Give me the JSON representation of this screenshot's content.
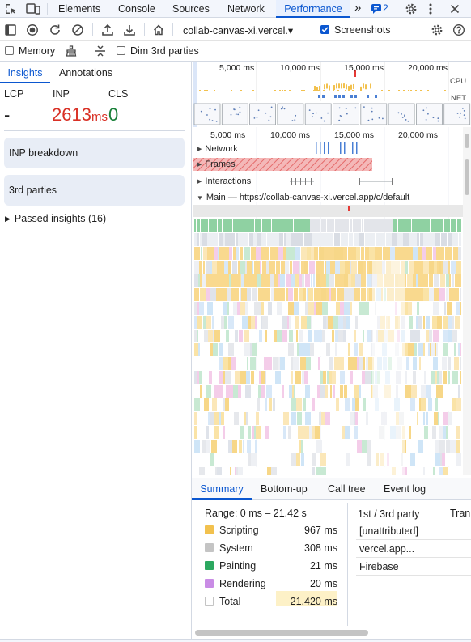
{
  "tabs": {
    "elements": "Elements",
    "console": "Console",
    "sources": "Sources",
    "network": "Network",
    "performance": "Performance",
    "more": "»",
    "issues_count": "2"
  },
  "toolbar": {
    "recording_select": "collab-canvas-xi.vercel.▾",
    "screenshots_label": "Screenshots",
    "screenshots_checked": true,
    "memory_label": "Memory",
    "memory_checked": false,
    "dim3p_label": "Dim 3rd parties",
    "dim3p_checked": false
  },
  "sidebar": {
    "tab_insights": "Insights",
    "tab_annotations": "Annotations",
    "lcp_label": "LCP",
    "inp_label": "INP",
    "cls_label": "CLS",
    "lcp_value": "-",
    "inp_value": "2613",
    "inp_unit": "ms",
    "cls_value": "0",
    "inp_breakdown": "INP breakdown",
    "third_parties": "3rd parties",
    "passed_insights": "Passed insights (16)"
  },
  "overview": {
    "ticks": [
      "5,000 ms",
      "10,000 ms",
      "15,000 ms",
      "20,000 ms"
    ],
    "cpu_label": "CPU",
    "net_label": "NET"
  },
  "timeline": {
    "ticks": [
      "5,000 ms",
      "10,000 ms",
      "15,000 ms",
      "20,000 ms"
    ],
    "network_label": "Network",
    "frames_label": "Frames",
    "interactions_label": "Interactions",
    "main_label": "Main — https://collab-canvas-xi.vercel.app/c/default"
  },
  "bottom": {
    "tabs": [
      "Summary",
      "Bottom-up",
      "Call tree",
      "Event log"
    ],
    "range": "Range: 0 ms – 21.42 s",
    "rows": [
      {
        "label": "Scripting",
        "value": "967 ms",
        "color": "#f2c14e"
      },
      {
        "label": "System",
        "value": "308 ms",
        "color": "#c4c4c4"
      },
      {
        "label": "Painting",
        "value": "21 ms",
        "color": "#2ca860"
      },
      {
        "label": "Rendering",
        "value": "20 ms",
        "color": "#c98ce5"
      },
      {
        "label": "Total",
        "value": "21,420 ms",
        "color": "#ffffff"
      }
    ],
    "party_header": "1st / 3rd party",
    "transfer_header": "Tran",
    "parties": [
      "[unattributed]",
      "vercel.app...",
      "Firebase"
    ]
  },
  "colors": {
    "accent": "#0b57d0",
    "inp_red": "#d93025",
    "cls_green": "#188038"
  }
}
